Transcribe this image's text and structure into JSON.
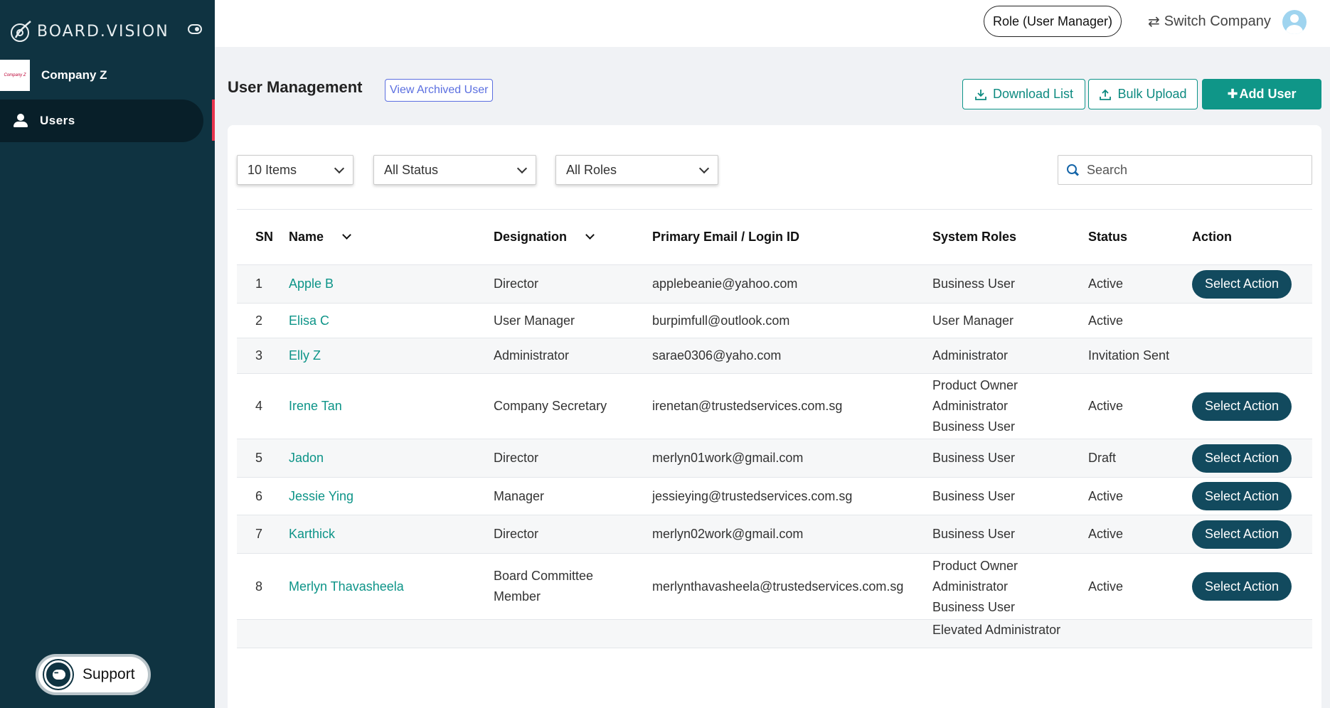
{
  "brand": {
    "name": "BOARD.VISION"
  },
  "company": {
    "name": "Company Z",
    "logo_text": "Company Z"
  },
  "sidebar": {
    "items": [
      {
        "label": "Users",
        "icon": "user-icon"
      }
    ]
  },
  "support": {
    "label": "Support"
  },
  "header": {
    "role": "Role (User Manager)",
    "switch_company": "Switch Company"
  },
  "page": {
    "title": "User Management",
    "archived_button": "View Archived User",
    "download_button": "Download List",
    "bulk_button": "Bulk Upload",
    "add_button": "Add User"
  },
  "filters": {
    "items": "10 Items",
    "status": "All Status",
    "roles": "All Roles",
    "search_placeholder": "Search"
  },
  "table": {
    "columns": [
      "SN",
      "Name",
      "Designation",
      "Primary Email / Login ID",
      "System Roles",
      "Status",
      "Action"
    ],
    "action_label": "Select Action",
    "rows": [
      {
        "sn": "1",
        "name": "Apple B",
        "designation": [
          "Director"
        ],
        "email": "applebeanie@yahoo.com",
        "roles": [
          "Business User"
        ],
        "status": "Active",
        "action": true
      },
      {
        "sn": "2",
        "name": "Elisa C",
        "designation": [
          "User Manager"
        ],
        "email": "burpimfull@outlook.com",
        "roles": [
          "User Manager"
        ],
        "status": "Active",
        "action": false
      },
      {
        "sn": "3",
        "name": "Elly Z",
        "designation": [
          "Administrator"
        ],
        "email": "sarae0306@yaho.com",
        "roles": [
          "Administrator"
        ],
        "status": "Invitation Sent",
        "action": false
      },
      {
        "sn": "4",
        "name": "Irene Tan",
        "designation": [
          "Company Secretary"
        ],
        "email": "irenetan@trustedservices.com.sg",
        "roles": [
          "Product Owner",
          "Administrator",
          "Business User"
        ],
        "status": "Active",
        "action": true
      },
      {
        "sn": "5",
        "name": "Jadon",
        "designation": [
          "Director"
        ],
        "email": "merlyn01work@gmail.com",
        "roles": [
          "Business User"
        ],
        "status": "Draft",
        "action": true
      },
      {
        "sn": "6",
        "name": "Jessie Ying",
        "designation": [
          "Manager"
        ],
        "email": "jessieying@trustedservices.com.sg",
        "roles": [
          "Business User"
        ],
        "status": "Active",
        "action": true
      },
      {
        "sn": "7",
        "name": "Karthick",
        "designation": [
          "Director"
        ],
        "email": "merlyn02work@gmail.com",
        "roles": [
          "Business User"
        ],
        "status": "Active",
        "action": true
      },
      {
        "sn": "8",
        "name": "Merlyn Thavasheela",
        "designation": [
          "Board Committee",
          "Member"
        ],
        "email": "merlynthavasheela@trustedservices.com.sg",
        "roles": [
          "Product Owner",
          "Administrator",
          "Business User"
        ],
        "status": "Active",
        "action": true
      },
      {
        "sn": "",
        "name": "",
        "designation": [],
        "email": "",
        "roles": [
          "Elevated Administrator"
        ],
        "status": "",
        "action": false
      }
    ]
  }
}
